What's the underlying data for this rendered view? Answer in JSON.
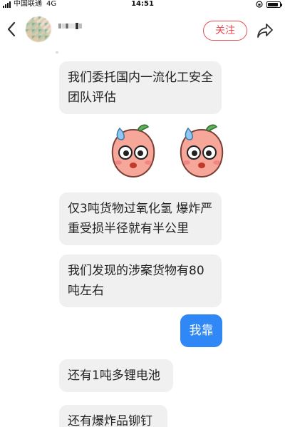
{
  "status_bar": {
    "carrier": "中国联通",
    "network": "4G",
    "time": "14:51",
    "battery_level": 0.9
  },
  "header": {
    "follow_label": "关注"
  },
  "messages": [
    {
      "direction": "incoming",
      "text": "我们委托国内一流化工安全团队评估"
    },
    {
      "direction": "incoming",
      "text": "仅3吨货物过氧化氢 爆炸严重受损半径就有半公里"
    },
    {
      "direction": "incoming",
      "text": "我们发现的涉案货物有80吨左右"
    },
    {
      "direction": "outgoing",
      "text": "我靠"
    },
    {
      "direction": "incoming",
      "text": "还有1吨多锂电池"
    },
    {
      "direction": "incoming",
      "text": "还有爆炸品铆钉"
    }
  ],
  "colors": {
    "accent_red": "#e64b50",
    "outgoing_bubble": "#2f88f6",
    "incoming_bubble": "#f0f0f0"
  }
}
